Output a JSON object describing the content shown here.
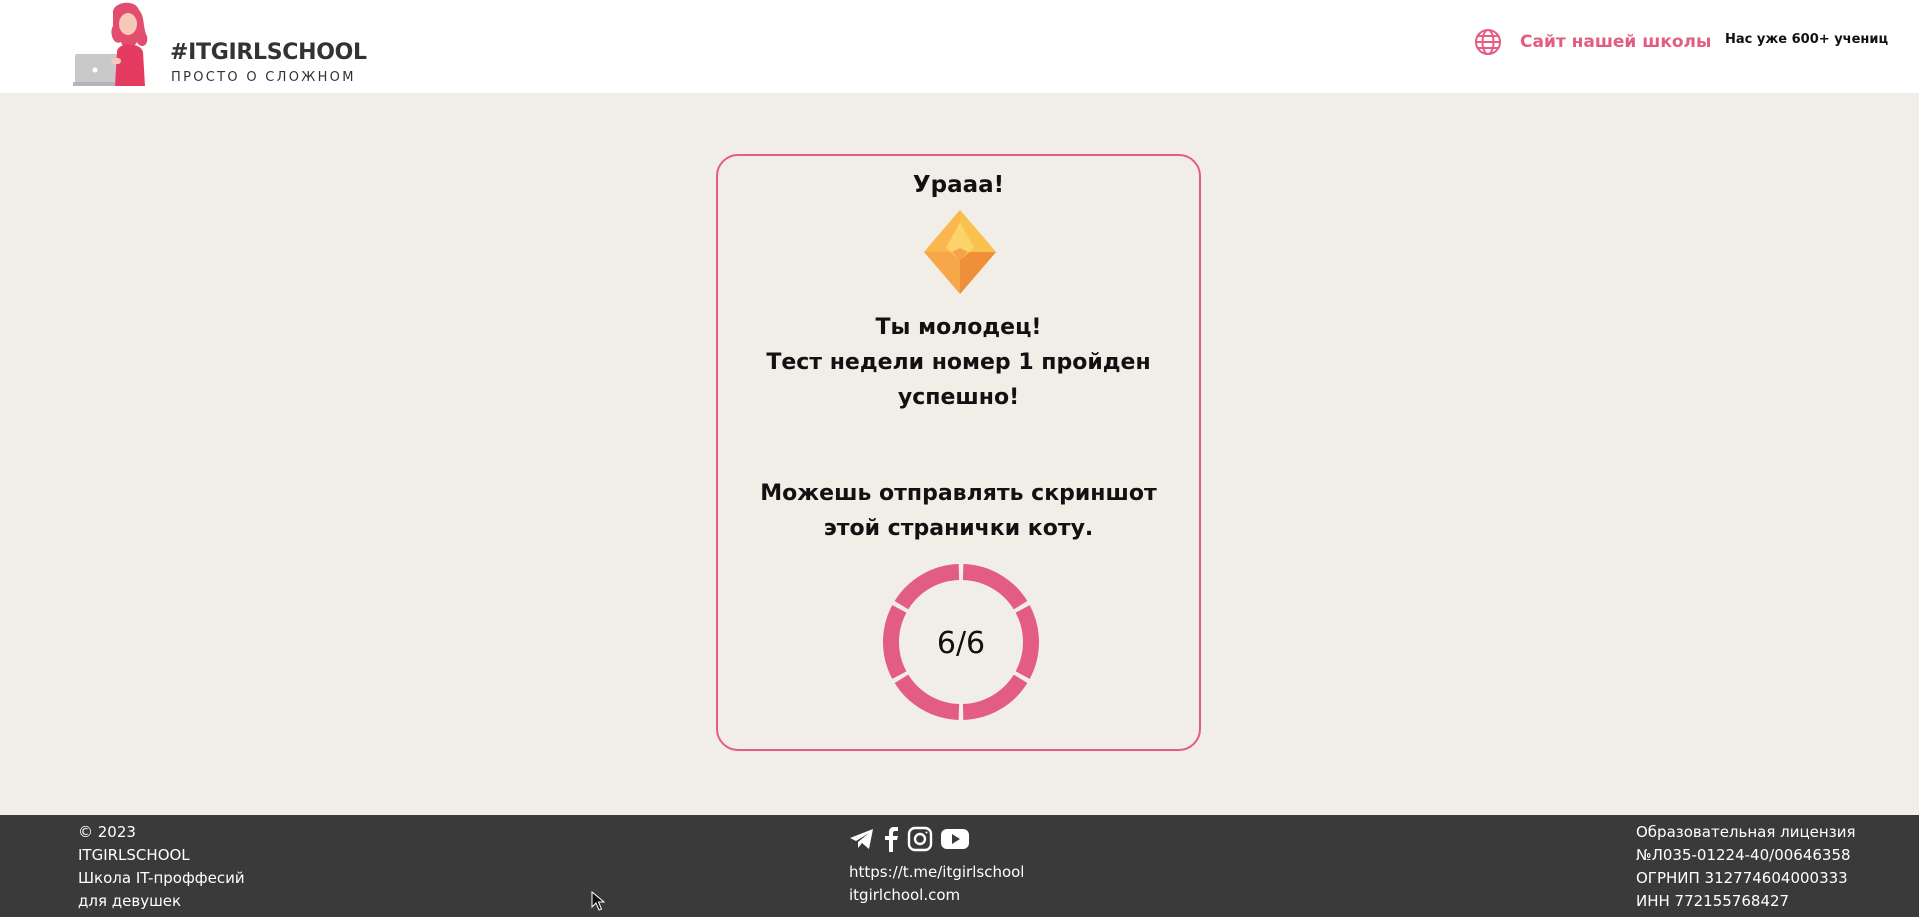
{
  "header": {
    "logo_title": "#ITGIRLSCHOOL",
    "logo_subtitle": "ПРОСТО О СЛОЖНОМ",
    "site_link_label": "Сайт нашей школы",
    "students_count": "Нас уже 600+ учениц"
  },
  "result": {
    "title": "Урааа!",
    "message_line1": "Ты молодец!",
    "message_line2": "Тест недели номер 1 пройден успешно!",
    "screenshot_note": "Можешь отправлять скриншот этой странички коту.",
    "score_text": "6/6",
    "score_correct": 6,
    "score_total": 6
  },
  "footer": {
    "left": [
      "© 2023",
      "ITGIRLSCHOOL",
      "Школа IT-проффесий",
      "для девушек"
    ],
    "socials": [
      "telegram-icon",
      "facebook-icon",
      "instagram-icon",
      "youtube-icon"
    ],
    "telegram_link": "https://t.me/itgirlschool",
    "site_link": "itgirlchool.com",
    "right": [
      "Образовательная лицензия",
      "№Л035-01224-40/00646358",
      "ОГРНИП 312774604000333",
      "ИНН 772155768427"
    ]
  },
  "colors": {
    "accent": "#e35d83",
    "page_background": "#f1eee7",
    "footer_background": "#3a3a3a"
  }
}
